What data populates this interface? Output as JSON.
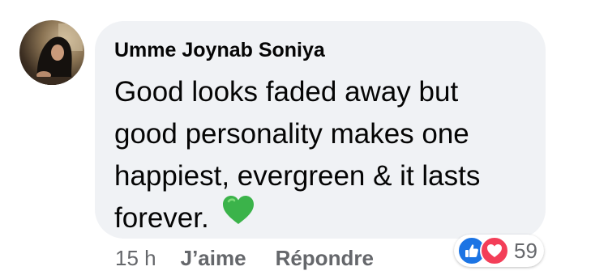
{
  "comment": {
    "author": "Umme Joynab Soniya",
    "text_lines": [
      "Good looks faded away but",
      "good personality makes one",
      "happiest, evergreen  & it lasts",
      "forever."
    ],
    "emoji": "green-heart-icon"
  },
  "reactions": {
    "icons": [
      "like-icon",
      "love-icon"
    ],
    "count": "59"
  },
  "actions": {
    "time": "15 h",
    "like_label": "J’aime",
    "reply_label": "Répondre"
  },
  "colors": {
    "bubble": "#f0f2f5",
    "text": "#050505",
    "secondary": "#65676b",
    "like_blue": "#1b74e4",
    "love_red": "#f33e58",
    "emoji_green": "#3bb34a"
  }
}
